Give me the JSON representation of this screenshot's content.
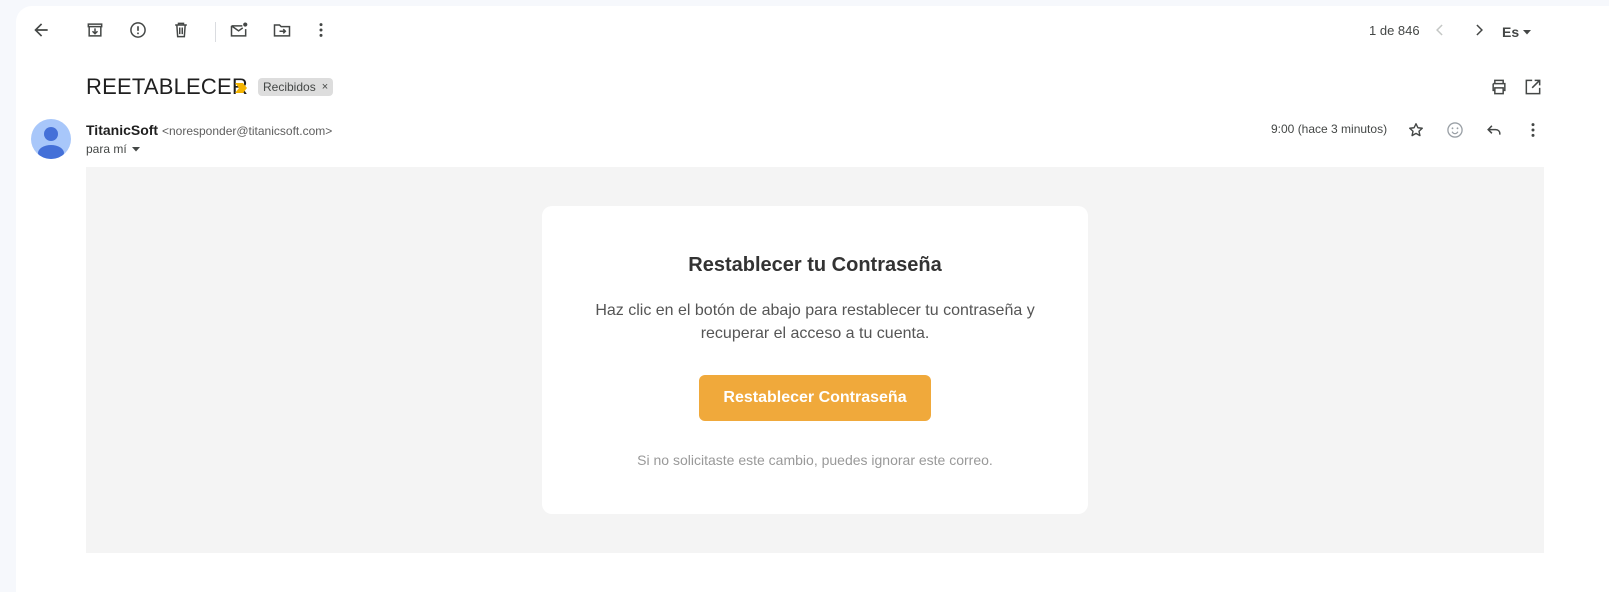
{
  "toolbar": {
    "back_icon": "arrow-left-icon",
    "archive_icon": "archive-icon",
    "spam_icon": "report-spam-icon",
    "delete_icon": "trash-icon",
    "mark_unread_icon": "mark-unread-icon",
    "move_icon": "move-to-folder-icon",
    "more_icon": "more-vert-icon",
    "counter": "1 de 846",
    "language": "Es"
  },
  "message": {
    "subject": "REETABLECER",
    "label": "Recibidos",
    "label_remove": "×",
    "sender_name": "TitanicSoft",
    "sender_email": "<noresponder@titanicsoft.com>",
    "to": "para mí",
    "time": "9:00 (hace 3 minutos)"
  },
  "email_content": {
    "title": "Restablecer tu Contraseña",
    "text": "Haz clic en el botón de abajo para restablecer tu contraseña y recuperar el acceso a tu cuenta.",
    "button": "Restablecer Contraseña",
    "footnote": "Si no solicitaste este cambio, puedes ignorar este correo."
  },
  "colors": {
    "accent_button": "#f0a93b",
    "importance_marker": "#f4b400",
    "avatar_bg": "#a8c7fa",
    "avatar_fg": "#4470d8"
  }
}
